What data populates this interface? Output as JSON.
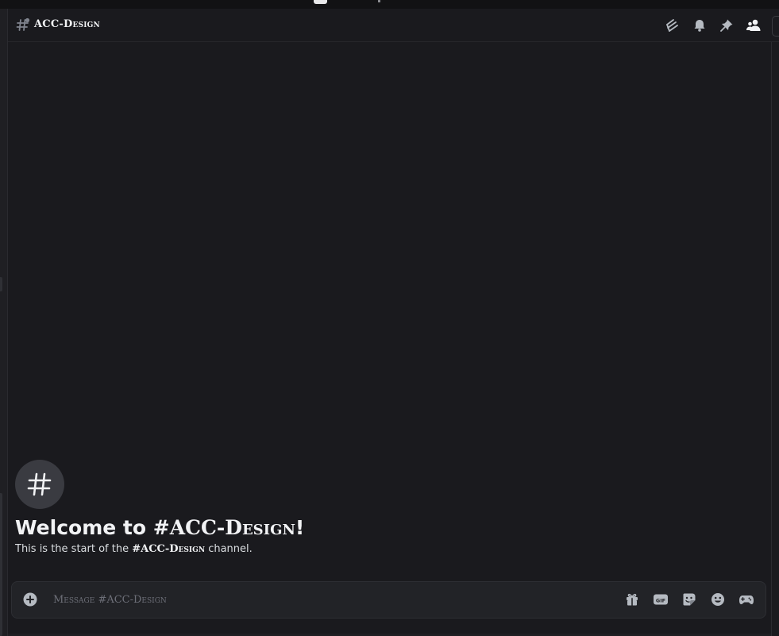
{
  "header": {
    "channel_name": "ACC-Design",
    "icons": [
      "threads-icon",
      "bell-icon",
      "pin-icon",
      "members-icon"
    ]
  },
  "welcome": {
    "title_prefix": "Welcome to ",
    "channel_ref": "#ACC-Design",
    "title_suffix": "!",
    "desc_prefix": "This is the start of the ",
    "desc_channel": "#ACC-Design",
    "desc_suffix": " channel."
  },
  "composer": {
    "placeholder": "Message #ACC-Design",
    "value": "",
    "icons": [
      "plus-circle-icon",
      "gift-icon",
      "gif-icon",
      "sticker-icon",
      "emoji-icon",
      "apps-icon"
    ]
  },
  "colors": {
    "background": "#1a1a1e",
    "header_text": "#f2f3f5",
    "muted_icon": "#b5bac1",
    "placeholder": "#6d6f78"
  }
}
